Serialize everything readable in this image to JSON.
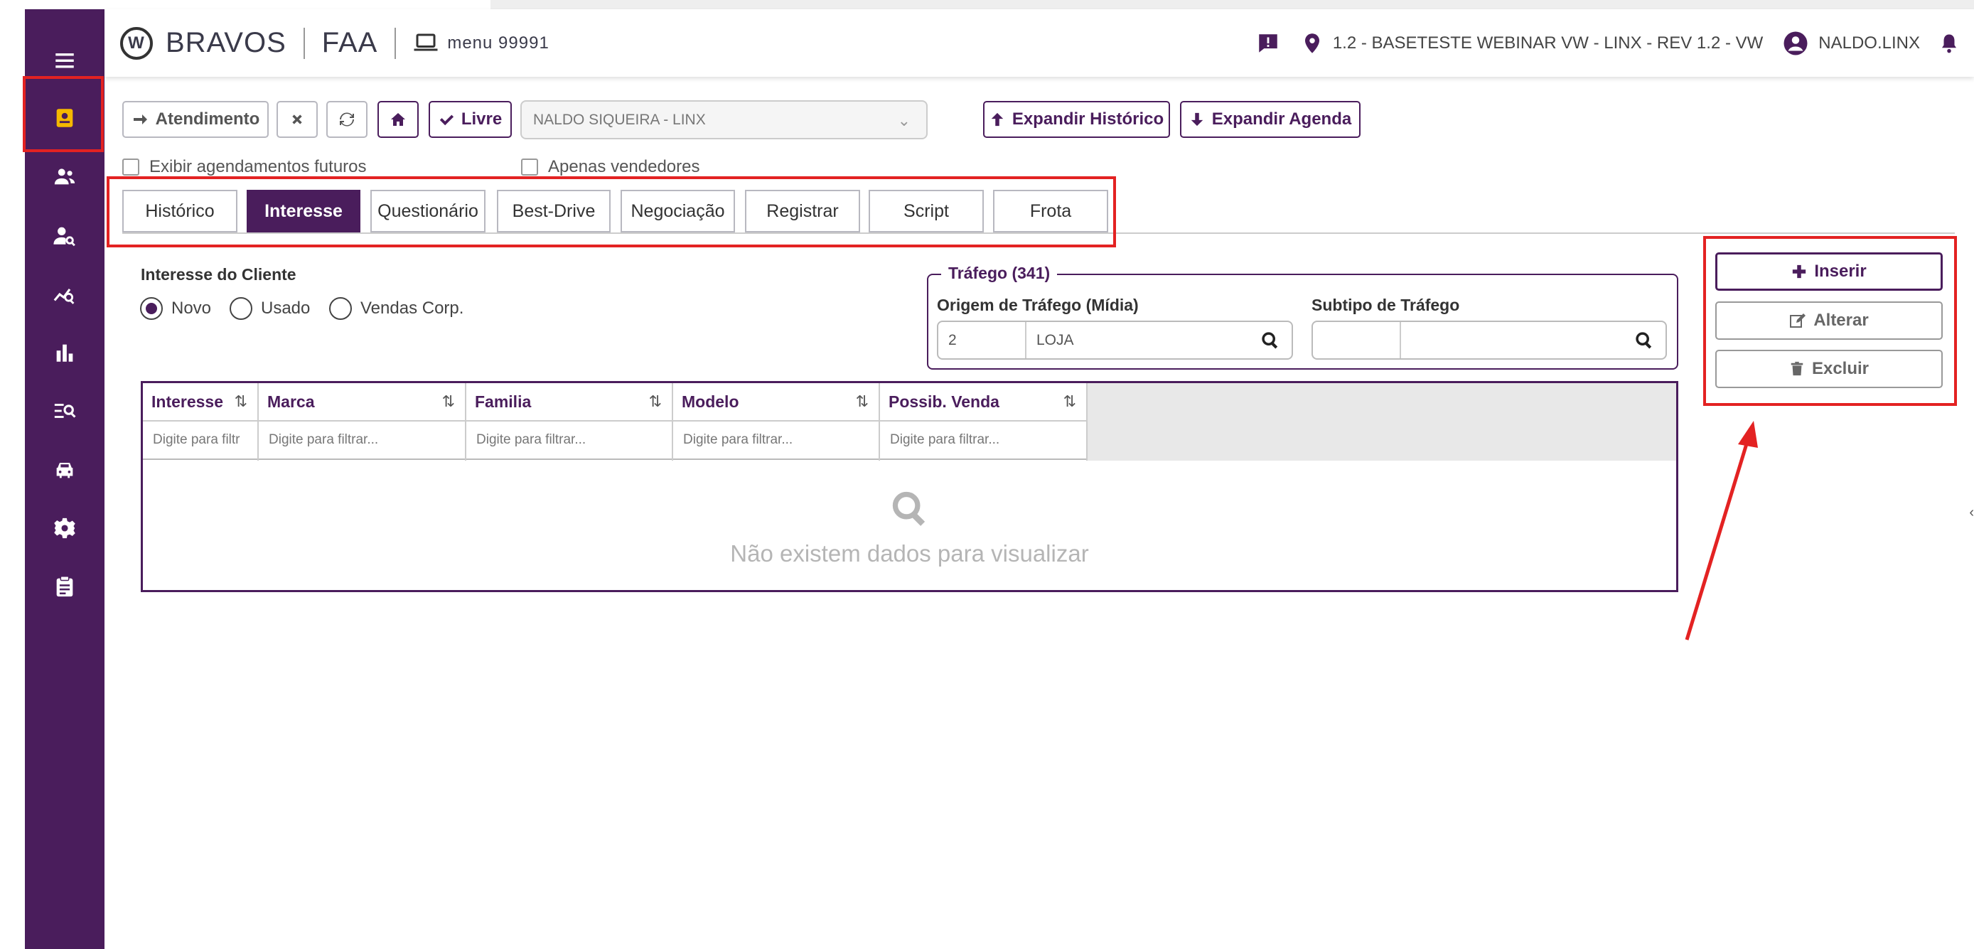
{
  "brand": {
    "name": "BRAVOS",
    "module": "FAA",
    "menu_label": "menu 99991"
  },
  "topbar": {
    "location": "1.2 - BASETESTE WEBINAR VW - LINX - REV 1.2 - VW",
    "user": "NALDO.LINX"
  },
  "toolbar": {
    "atendimento_label": "Atendimento",
    "livre_label": "Livre",
    "vendor_select": "NALDO SIQUEIRA - LINX",
    "expand_history_label": "Expandir Histórico",
    "expand_agenda_label": "Expandir Agenda"
  },
  "checks": {
    "future_label": "Exibir agendamentos futuros",
    "sellers_label": "Apenas vendedores"
  },
  "tabs": [
    {
      "label": "Histórico"
    },
    {
      "label": "Interesse"
    },
    {
      "label": "Questionário"
    },
    {
      "label": "Best-Drive"
    },
    {
      "label": "Negociação"
    },
    {
      "label": "Registrar"
    },
    {
      "label": "Script"
    },
    {
      "label": "Frota"
    }
  ],
  "interest": {
    "title": "Interesse do Cliente",
    "options": [
      {
        "label": "Novo",
        "selected": true
      },
      {
        "label": "Usado",
        "selected": false
      },
      {
        "label": "Vendas Corp.",
        "selected": false
      }
    ]
  },
  "traffic": {
    "legend": "Tráfego (341)",
    "origin_label": "Origem de Tráfego (Mídia)",
    "origin_code": "2",
    "origin_name": "LOJA",
    "subtype_label": "Subtipo de Tráfego",
    "subtype_code": "",
    "subtype_name": ""
  },
  "grid": {
    "columns": [
      {
        "header": "Interesse",
        "filter": "Digite para filtr"
      },
      {
        "header": "Marca",
        "filter": "Digite para filtrar..."
      },
      {
        "header": "Familia",
        "filter": "Digite para filtrar..."
      },
      {
        "header": "Modelo",
        "filter": "Digite para filtrar..."
      },
      {
        "header": "Possib. Venda",
        "filter": "Digite para filtrar..."
      }
    ],
    "empty_text": "Não existem dados para visualizar"
  },
  "actions": {
    "insert_label": "Inserir",
    "edit_label": "Alterar",
    "delete_label": "Excluir"
  },
  "colors": {
    "primary": "#4a1d5c",
    "highlight": "#e32222",
    "accent_icon": "#f5b800"
  }
}
